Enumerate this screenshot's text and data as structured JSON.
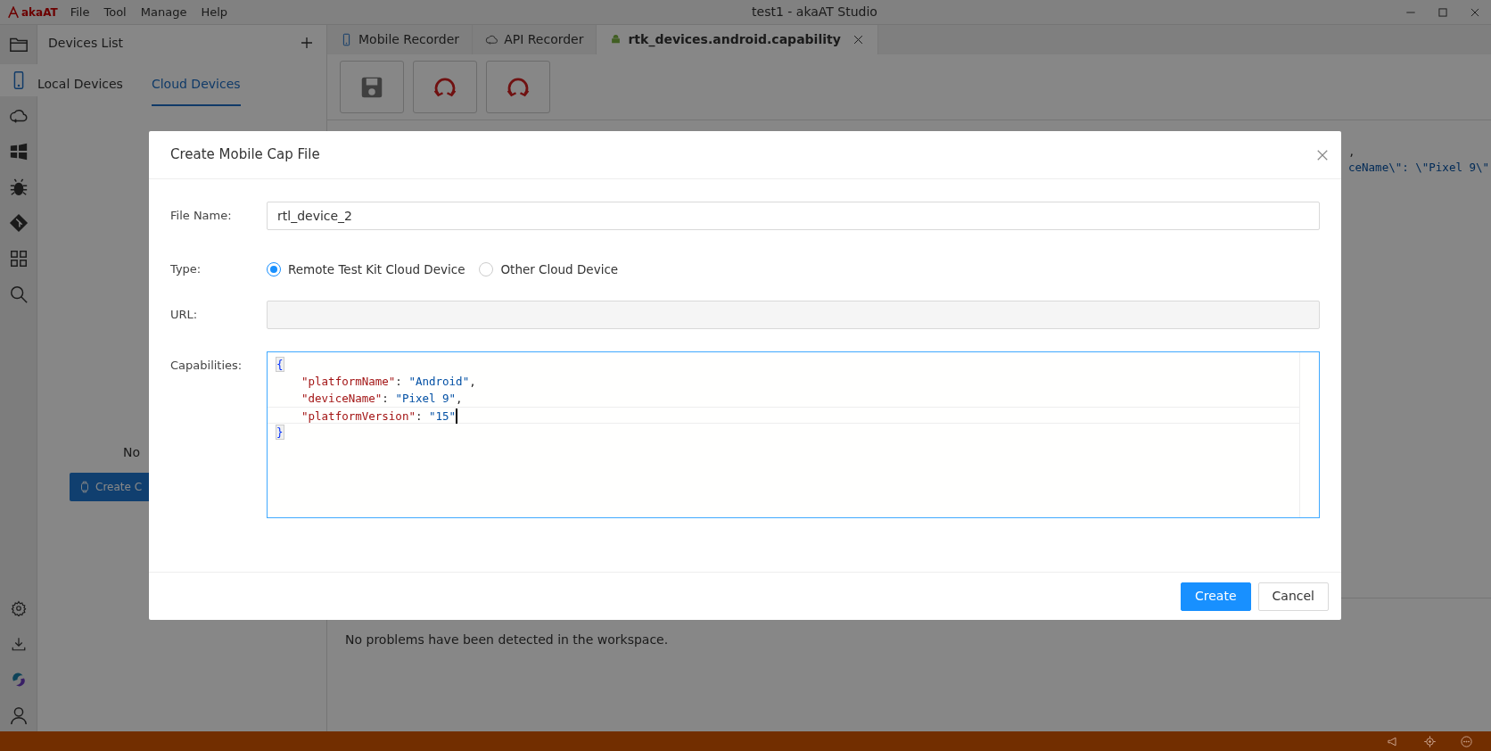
{
  "window": {
    "title": "test1 - akaAT Studio",
    "logo": "akaAT"
  },
  "menu": [
    "File",
    "Tool",
    "Manage",
    "Help"
  ],
  "activity_bar": [
    {
      "selected": false
    },
    {
      "selected": true
    },
    {
      "selected": false
    },
    {
      "selected": false
    },
    {
      "selected": false
    },
    {
      "selected": false
    },
    {
      "selected": false
    },
    {
      "selected": false
    }
  ],
  "side_panel": {
    "title": "Devices List",
    "tabs": [
      {
        "label": "Local Devices",
        "selected": false
      },
      {
        "label": "Cloud Devices",
        "selected": true
      }
    ],
    "empty_text": "No",
    "button": "Create C"
  },
  "editor_tabs": [
    {
      "label": "Mobile Recorder",
      "selected": false,
      "closable": false
    },
    {
      "label": "API Recorder",
      "selected": false,
      "closable": false
    },
    {
      "label": "rtk_devices.android.capability",
      "selected": true,
      "closable": true
    }
  ],
  "editor_fragments": [
    ",",
    "ceName\\\": \\\"Pixel 9\\\""
  ],
  "problems": {
    "text": "No problems have been detected in the workspace."
  },
  "dialog": {
    "title": "Create Mobile Cap File",
    "file_name": {
      "label": "File Name:",
      "value": "rtl_device_2"
    },
    "type": {
      "label": "Type:",
      "options": [
        {
          "label": "Remote Test Kit Cloud Device",
          "selected": true
        },
        {
          "label": "Other Cloud Device",
          "selected": false
        }
      ]
    },
    "url": {
      "label": "URL:",
      "disabled": true
    },
    "capabilities": {
      "label": "Capabilities:",
      "lines": [
        {
          "current": false,
          "tokens": [
            {
              "kind": "brace",
              "text": "{"
            }
          ]
        },
        {
          "current": false,
          "tokens": [
            {
              "kind": "key",
              "text": "\"platformName\""
            },
            {
              "kind": "punct",
              "text": ": "
            },
            {
              "kind": "value",
              "text": "\"Android\""
            },
            {
              "kind": "punct",
              "text": ","
            }
          ]
        },
        {
          "current": false,
          "tokens": [
            {
              "kind": "key",
              "text": "\"deviceName\""
            },
            {
              "kind": "punct",
              "text": ": "
            },
            {
              "kind": "value",
              "text": "\"Pixel 9\""
            },
            {
              "kind": "punct",
              "text": ","
            }
          ]
        },
        {
          "current": true,
          "tokens": [
            {
              "kind": "key",
              "text": "\"platformVersion\""
            },
            {
              "kind": "punct",
              "text": ": "
            },
            {
              "kind": "value",
              "text": "\"15\""
            }
          ]
        },
        {
          "current": false,
          "tokens": [
            {
              "kind": "brace",
              "text": "}"
            }
          ]
        }
      ]
    },
    "buttons": [
      {
        "label": "Create",
        "kind": "primary"
      },
      {
        "label": "Cancel",
        "kind": "secondary"
      }
    ]
  }
}
